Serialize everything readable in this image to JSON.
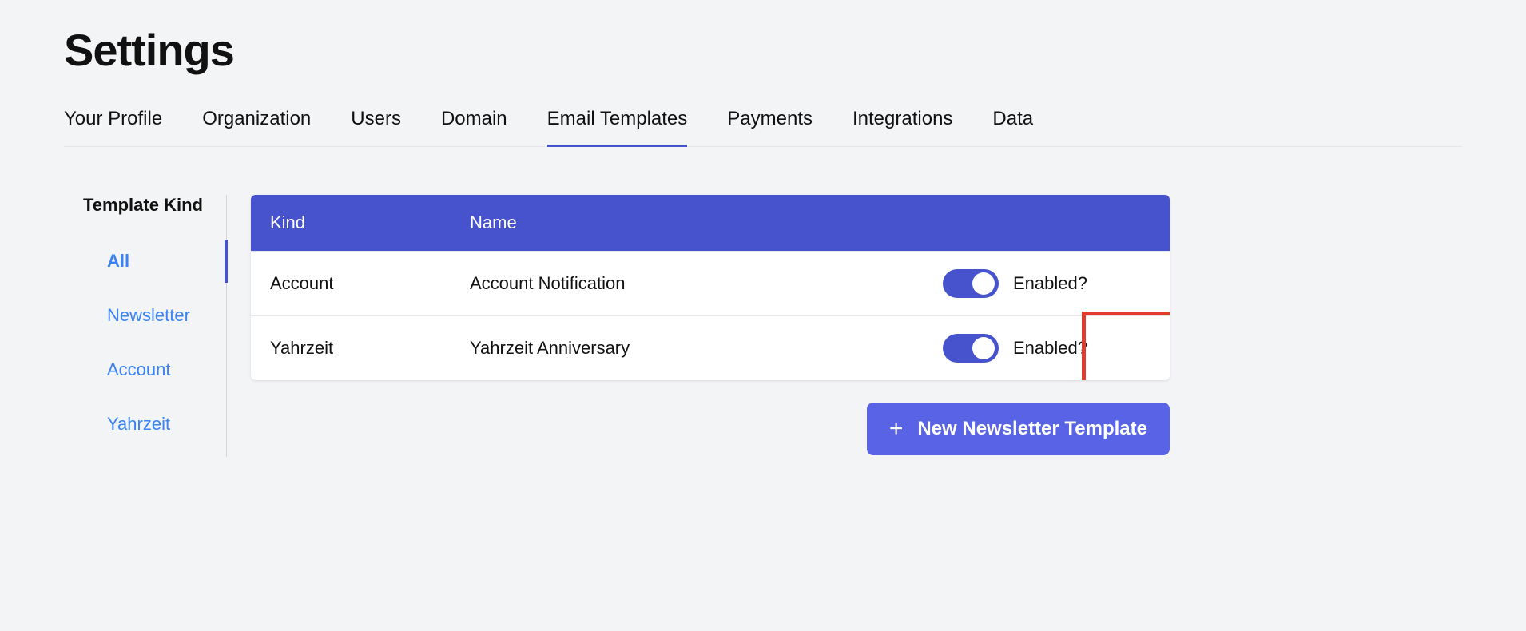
{
  "page": {
    "title": "Settings"
  },
  "tabs": [
    {
      "label": "Your Profile"
    },
    {
      "label": "Organization"
    },
    {
      "label": "Users"
    },
    {
      "label": "Domain"
    },
    {
      "label": "Email Templates"
    },
    {
      "label": "Payments"
    },
    {
      "label": "Integrations"
    },
    {
      "label": "Data"
    }
  ],
  "sidebar": {
    "heading": "Template Kind",
    "items": [
      {
        "label": "All"
      },
      {
        "label": "Newsletter"
      },
      {
        "label": "Account"
      },
      {
        "label": "Yahrzeit"
      }
    ]
  },
  "table": {
    "headers": {
      "kind": "Kind",
      "name": "Name"
    },
    "rows": [
      {
        "kind": "Account",
        "name": "Account Notification",
        "enabled_label": "Enabled?"
      },
      {
        "kind": "Yahrzeit",
        "name": "Yahrzeit Anniversary",
        "enabled_label": "Enabled?"
      }
    ]
  },
  "buttons": {
    "new_template": "New Newsletter Template"
  }
}
